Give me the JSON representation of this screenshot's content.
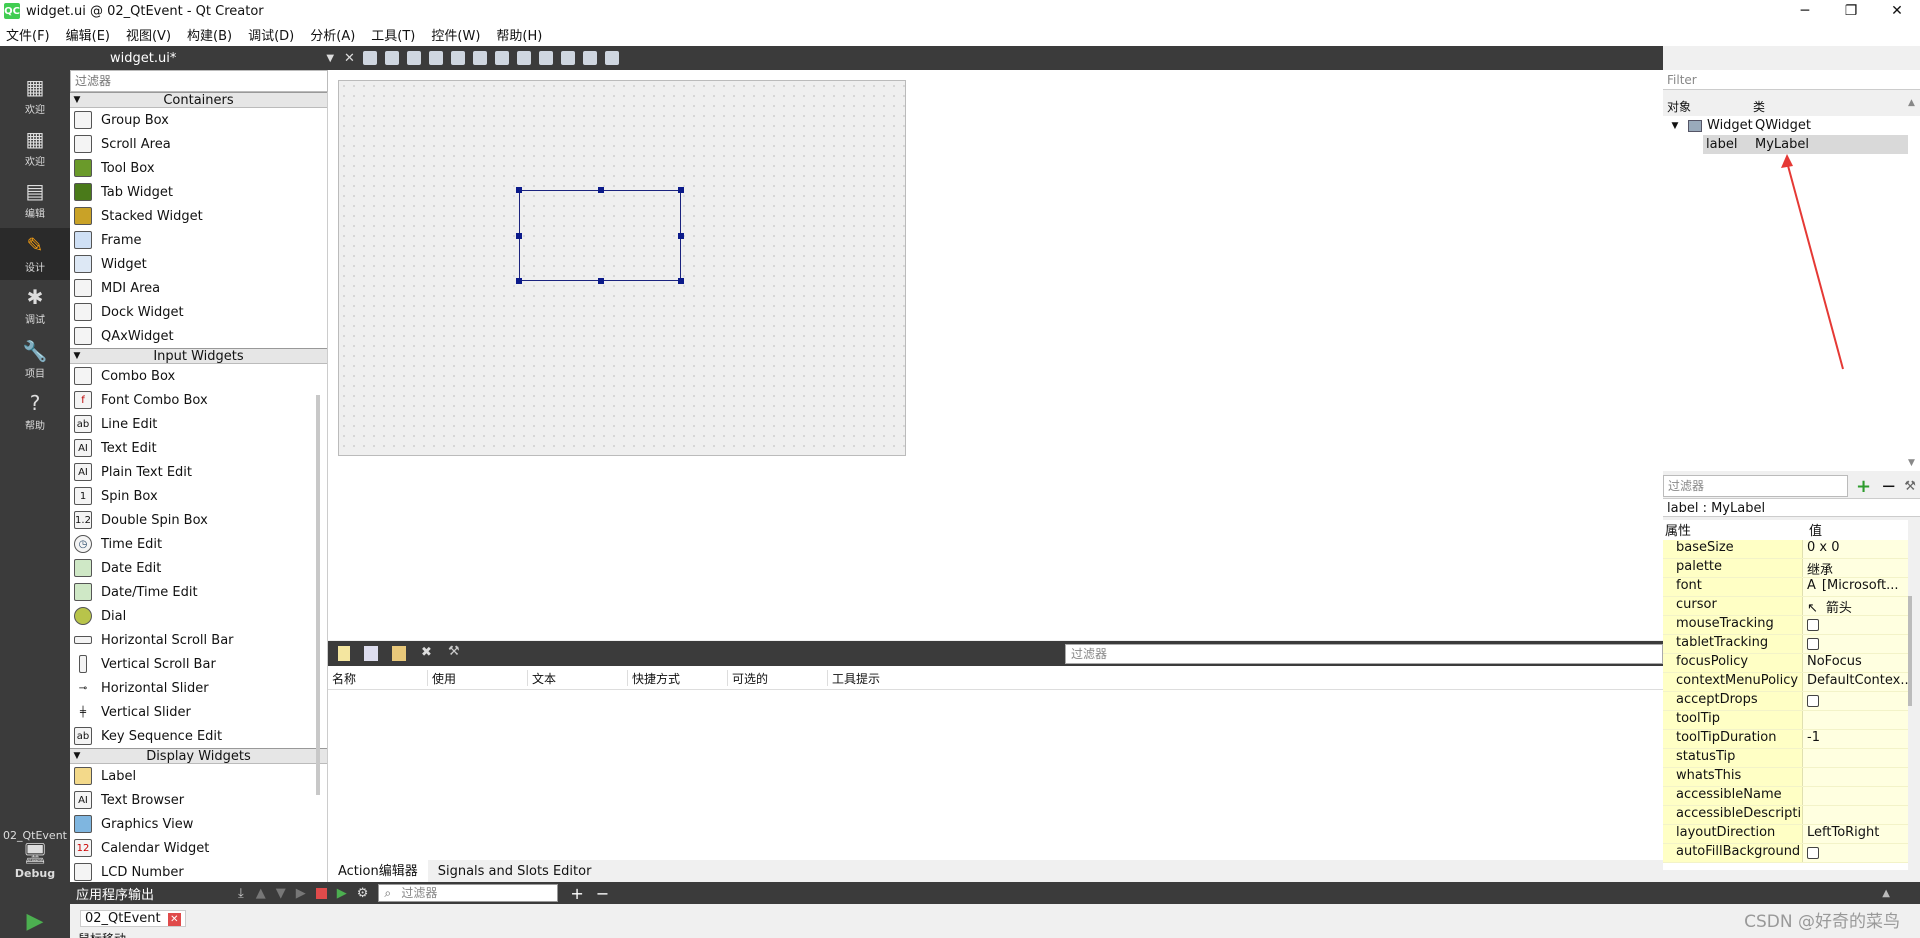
{
  "window": {
    "title": "widget.ui @ 02_QtEvent - Qt Creator",
    "logo_text": "QC",
    "controls": [
      "─",
      "❐",
      "✕"
    ]
  },
  "menus": [
    "文件(F)",
    "编辑(E)",
    "视图(V)",
    "构建(B)",
    "调试(D)",
    "分析(A)",
    "工具(T)",
    "控件(W)",
    "帮助(H)"
  ],
  "modes": [
    {
      "label": "欢迎",
      "icon": "grid-icon"
    },
    {
      "label": "欢迎",
      "icon": "grid-icon"
    },
    {
      "label": "编辑",
      "icon": "document-icon"
    },
    {
      "label": "设计",
      "icon": "pencil-icon"
    },
    {
      "label": "调试",
      "icon": "bug-icon"
    },
    {
      "label": "项目",
      "icon": "wrench-icon"
    },
    {
      "label": "帮助",
      "icon": "help-icon"
    }
  ],
  "kit": {
    "project": "02_QtEvent",
    "build": "Debug"
  },
  "editor": {
    "file_name": "widget.ui*"
  },
  "widget_box": {
    "filter_placeholder": "过滤器",
    "categories": [
      {
        "name": "Containers",
        "items": [
          "Group Box",
          "Scroll Area",
          "Tool Box",
          "Tab Widget",
          "Stacked Widget",
          "Frame",
          "Widget",
          "MDI Area",
          "Dock Widget",
          "QAxWidget"
        ]
      },
      {
        "name": "Input Widgets",
        "items": [
          "Combo Box",
          "Font Combo Box",
          "Line Edit",
          "Text Edit",
          "Plain Text Edit",
          "Spin Box",
          "Double Spin Box",
          "Time Edit",
          "Date Edit",
          "Date/Time Edit",
          "Dial",
          "Horizontal Scroll Bar",
          "Vertical Scroll Bar",
          "Horizontal Slider",
          "Vertical Slider",
          "Key Sequence Edit"
        ]
      },
      {
        "name": "Display Widgets",
        "items": [
          "Label",
          "Text Browser",
          "Graphics View",
          "Calendar Widget",
          "LCD Number"
        ]
      }
    ]
  },
  "action_editor": {
    "filter_placeholder": "过滤器",
    "columns": [
      "名称",
      "使用",
      "文本",
      "快捷方式",
      "可选的",
      "工具提示"
    ]
  },
  "bottom_tabs": [
    "Action编辑器",
    "Signals and Slots Editor"
  ],
  "object_inspector": {
    "filter_placeholder": "Filter",
    "columns": [
      "对象",
      "类"
    ],
    "rows": [
      {
        "object": "Widget",
        "class": "QWidget"
      },
      {
        "object": "label",
        "class": "MyLabel"
      }
    ]
  },
  "property_editor": {
    "filter_placeholder": "过滤器",
    "object_label": "label : MyLabel",
    "columns": [
      "属性",
      "值"
    ],
    "properties": [
      {
        "name": "baseSize",
        "value": "0 x 0"
      },
      {
        "name": "palette",
        "value": "继承"
      },
      {
        "name": "font",
        "value": "[Microsoft..."
      },
      {
        "name": "cursor",
        "value": "箭头"
      },
      {
        "name": "mouseTracking",
        "value": ""
      },
      {
        "name": "tabletTracking",
        "value": ""
      },
      {
        "name": "focusPolicy",
        "value": "NoFocus"
      },
      {
        "name": "contextMenuPolicy",
        "value": "DefaultContex..."
      },
      {
        "name": "acceptDrops",
        "value": ""
      },
      {
        "name": "toolTip",
        "value": ""
      },
      {
        "name": "toolTipDuration",
        "value": "-1"
      },
      {
        "name": "statusTip",
        "value": ""
      },
      {
        "name": "whatsThis",
        "value": ""
      },
      {
        "name": "accessibleName",
        "value": ""
      },
      {
        "name": "accessibleDescripti...",
        "value": ""
      },
      {
        "name": "layoutDirection",
        "value": "LeftToRight"
      },
      {
        "name": "autoFillBackground",
        "value": ""
      }
    ]
  },
  "output": {
    "title": "应用程序输出",
    "filter_placeholder": "过滤器",
    "tab": "02_QtEvent",
    "text": "鼠标移动"
  },
  "watermark": "CSDN @好奇的菜鸟",
  "colors": {
    "dark_panel": "#3b3b3b",
    "selection": "#1a237e",
    "property_bg": "#ffffc5",
    "annotation_arrow": "#e53935"
  }
}
